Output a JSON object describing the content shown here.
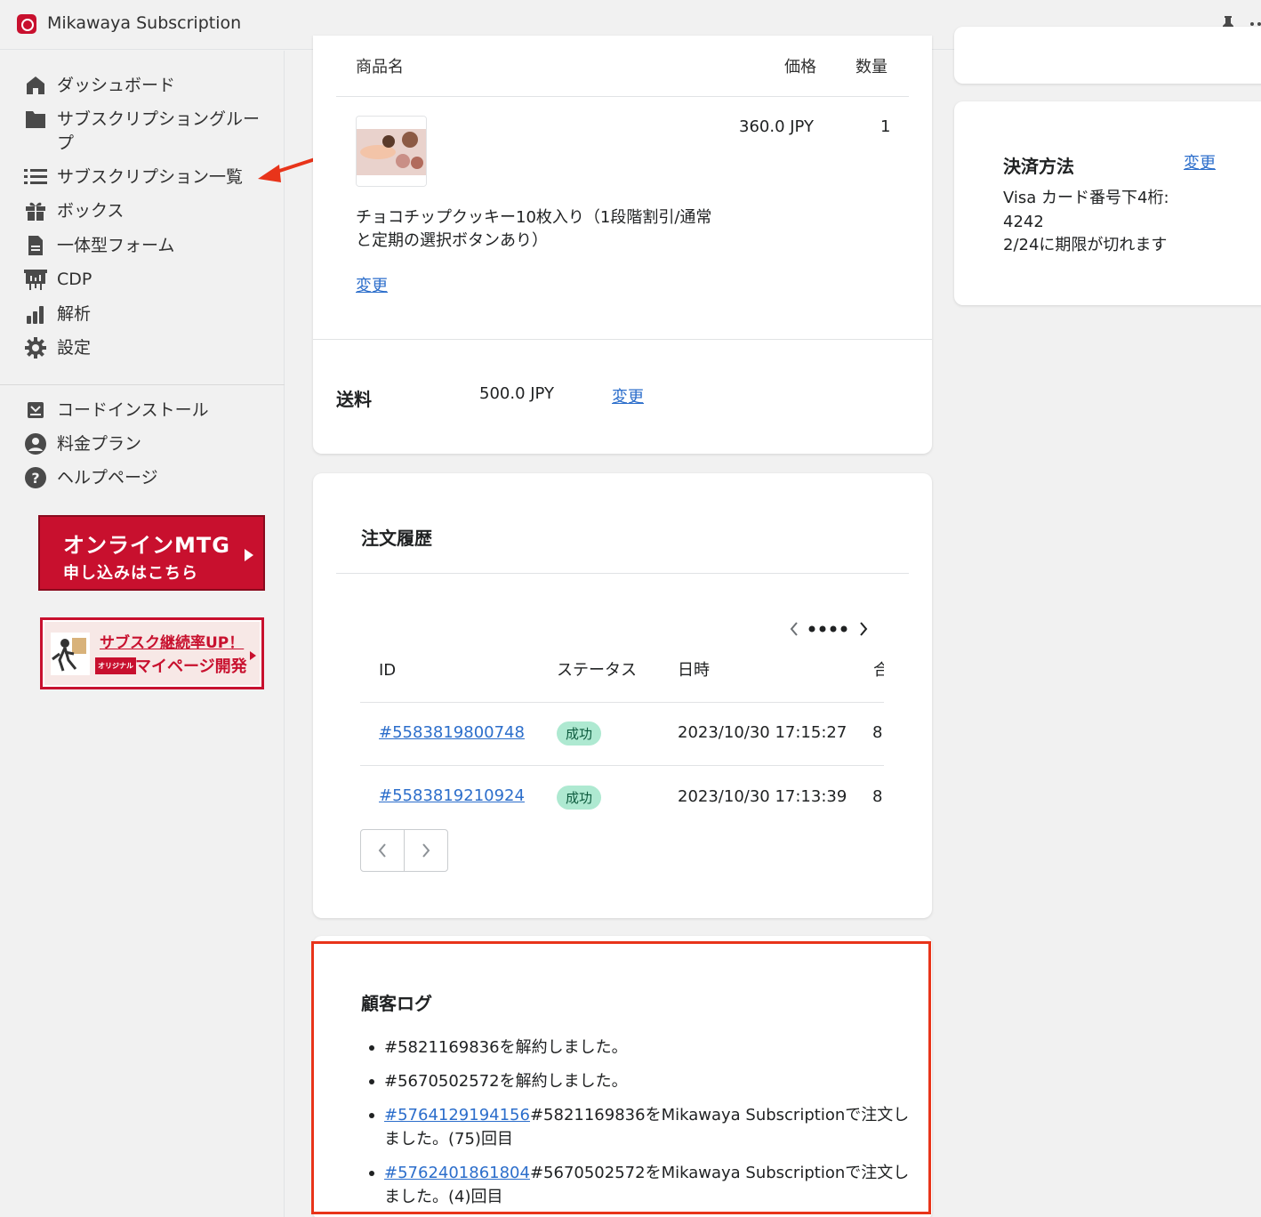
{
  "app": {
    "title": "Mikawaya Subscription"
  },
  "sidebar": {
    "items": [
      {
        "label": "ダッシュボード",
        "icon": "home-icon"
      },
      {
        "label": "サブスクリプショングループ",
        "icon": "folder-icon"
      },
      {
        "label": "サブスクリプション一覧",
        "icon": "list-icon"
      },
      {
        "label": "ボックス",
        "icon": "gift-icon"
      },
      {
        "label": "一体型フォーム",
        "icon": "document-icon"
      },
      {
        "label": "CDP",
        "icon": "presentation-icon"
      },
      {
        "label": "解析",
        "icon": "bar-chart-icon"
      },
      {
        "label": "設定",
        "icon": "gear-icon"
      }
    ],
    "secondary_items": [
      {
        "label": "コードインストール",
        "icon": "install-icon"
      },
      {
        "label": "料金プラン",
        "icon": "user-circle-icon"
      },
      {
        "label": "ヘルプページ",
        "icon": "help-icon"
      }
    ],
    "banner_mtg": {
      "line1": "オンラインMTG",
      "line2": "申し込みはこちら"
    },
    "banner_mypage": {
      "line1": "サブスク継続率UP！",
      "tag": "オリジナル",
      "line2": "マイページ開発"
    }
  },
  "products": {
    "col_name": "商品名",
    "col_price": "価格",
    "col_qty": "数量",
    "item": {
      "name": "チョコチップクッキー10枚入り（1段階割引/通常と定期の選択ボタンあり）",
      "price": "360.0 JPY",
      "qty": "1",
      "change": "変更"
    },
    "shipping": {
      "label": "送料",
      "value": "500.0 JPY",
      "change": "変更"
    }
  },
  "payment": {
    "title": "決済方法",
    "change": "変更",
    "line1": "Visa  カード番号下4桁:",
    "line2": "4242",
    "line3": "2/24に期限が切れます"
  },
  "orders": {
    "title": "注文履歴",
    "columns": {
      "id": "ID",
      "status": "ステータス",
      "date": "日時",
      "total": "合"
    },
    "rows": [
      {
        "id": "#5583819800748",
        "status": "成功",
        "date": "2023/10/30 17:15:27",
        "total": "8"
      },
      {
        "id": "#5583819210924",
        "status": "成功",
        "date": "2023/10/30 17:13:39",
        "total": "8"
      }
    ]
  },
  "customer_log": {
    "title": "顧客ログ",
    "entries": [
      {
        "link": "",
        "text": "#5821169836を解約しました。"
      },
      {
        "link": "",
        "text": "#5670502572を解約しました。"
      },
      {
        "link": "#5764129194156",
        "text": "#5821169836をMikawaya Subscriptionで注文しました。(75)回目"
      },
      {
        "link": "#5762401861804",
        "text": "#5670502572をMikawaya Subscriptionで注文しました。(4)回目"
      }
    ]
  },
  "colors": {
    "accent": "#c8102e",
    "link": "#2c6ecb",
    "success_bg": "#aee9d1",
    "highlight": "#e8341a"
  }
}
